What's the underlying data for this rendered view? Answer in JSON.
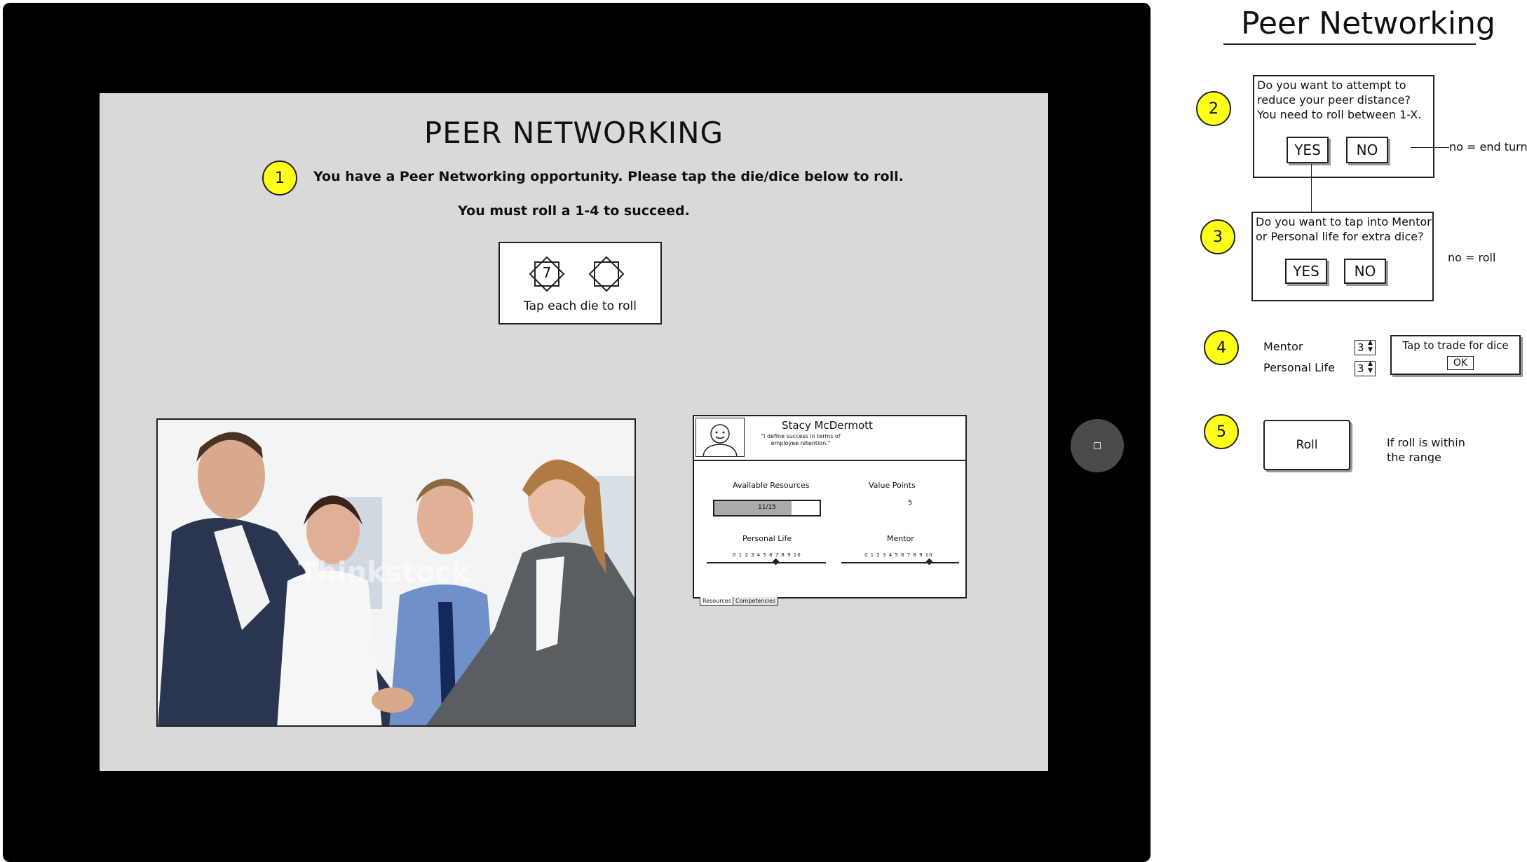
{
  "screen": {
    "title": "PEER NETWORKING",
    "step1_badge": "1",
    "instruction": "You have a Peer Networking opportunity. Please tap the die/dice below to roll.",
    "requirement": "You must roll a 1-4 to succeed.",
    "dice": {
      "die1_value": "7",
      "hint": "Tap each die to roll"
    },
    "photo": {
      "watermark": "Thinkstock"
    },
    "profile": {
      "name": "Stacy McDermott",
      "quote": "\"I define success in terms of employee retention.\"",
      "available_resources_label": "Available Resources",
      "available_resources_value": "11/15",
      "available_resources_fraction": 0.73,
      "value_points_label": "Value Points",
      "value_points_value": "5",
      "personal_life_label": "Personal Life",
      "mentor_label": "Mentor",
      "scale_ticks": "0 1 2 3 4 5 6 7 8 9 10",
      "tabs": [
        "Resources",
        "Competencies"
      ]
    }
  },
  "annotations": {
    "heading": "Peer Networking",
    "step2": {
      "badge": "2",
      "question": "Do you want to attempt to reduce your peer distance? You need to roll between 1-X.",
      "yes": "YES",
      "no": "NO",
      "note": "no = end turn"
    },
    "step3": {
      "badge": "3",
      "question": "Do you want to tap into Mentor or Personal life for extra dice?",
      "yes": "YES",
      "no": "NO",
      "note": "no = roll"
    },
    "step4": {
      "badge": "4",
      "mentor_label": "Mentor",
      "mentor_value": "3",
      "personal_life_label": "Personal Life",
      "personal_life_value": "3",
      "trade_text": "Tap to trade for dice",
      "ok": "OK"
    },
    "step5": {
      "badge": "5",
      "roll": "Roll",
      "note": "If roll is within the range"
    }
  }
}
